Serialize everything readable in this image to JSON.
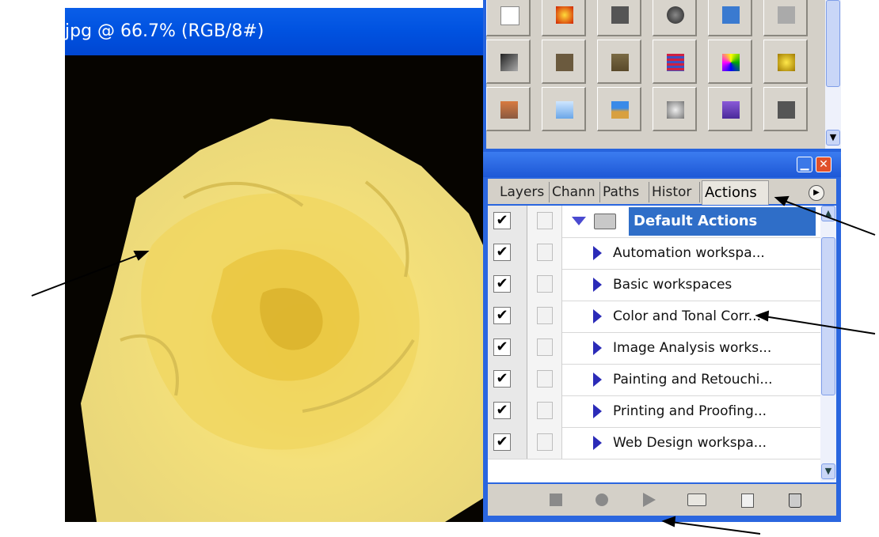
{
  "document": {
    "title": "jpg @ 66.7% (RGB/8#)"
  },
  "panel_tabs": [
    {
      "label": "Layers"
    },
    {
      "label": "Chann"
    },
    {
      "label": "Paths"
    },
    {
      "label": "Histor"
    },
    {
      "label": "Actions",
      "active": true
    }
  ],
  "actions": {
    "set_name": "Default Actions",
    "items": [
      {
        "label": "Automation workspa..."
      },
      {
        "label": "Basic workspaces"
      },
      {
        "label": "Color and Tonal Corr..."
      },
      {
        "label": "Image Analysis works..."
      },
      {
        "label": "Painting and Retouchi..."
      },
      {
        "label": "Printing and Proofing..."
      },
      {
        "label": "Web Design workspa..."
      }
    ],
    "check_mark": "✔"
  },
  "icons": {
    "minimize": "minimize-icon",
    "close": "close-icon",
    "panel_menu": "panel-menu-icon",
    "stop": "stop-icon",
    "record": "record-icon",
    "play": "play-icon",
    "new_set": "folder-icon",
    "new_action": "new-action-icon",
    "delete": "trash-icon"
  },
  "colors": {
    "titlebar": "#0052e0",
    "selection": "#2f6ec8",
    "panel_bg": "#d4d0c8",
    "close_button": "#e0502a"
  }
}
